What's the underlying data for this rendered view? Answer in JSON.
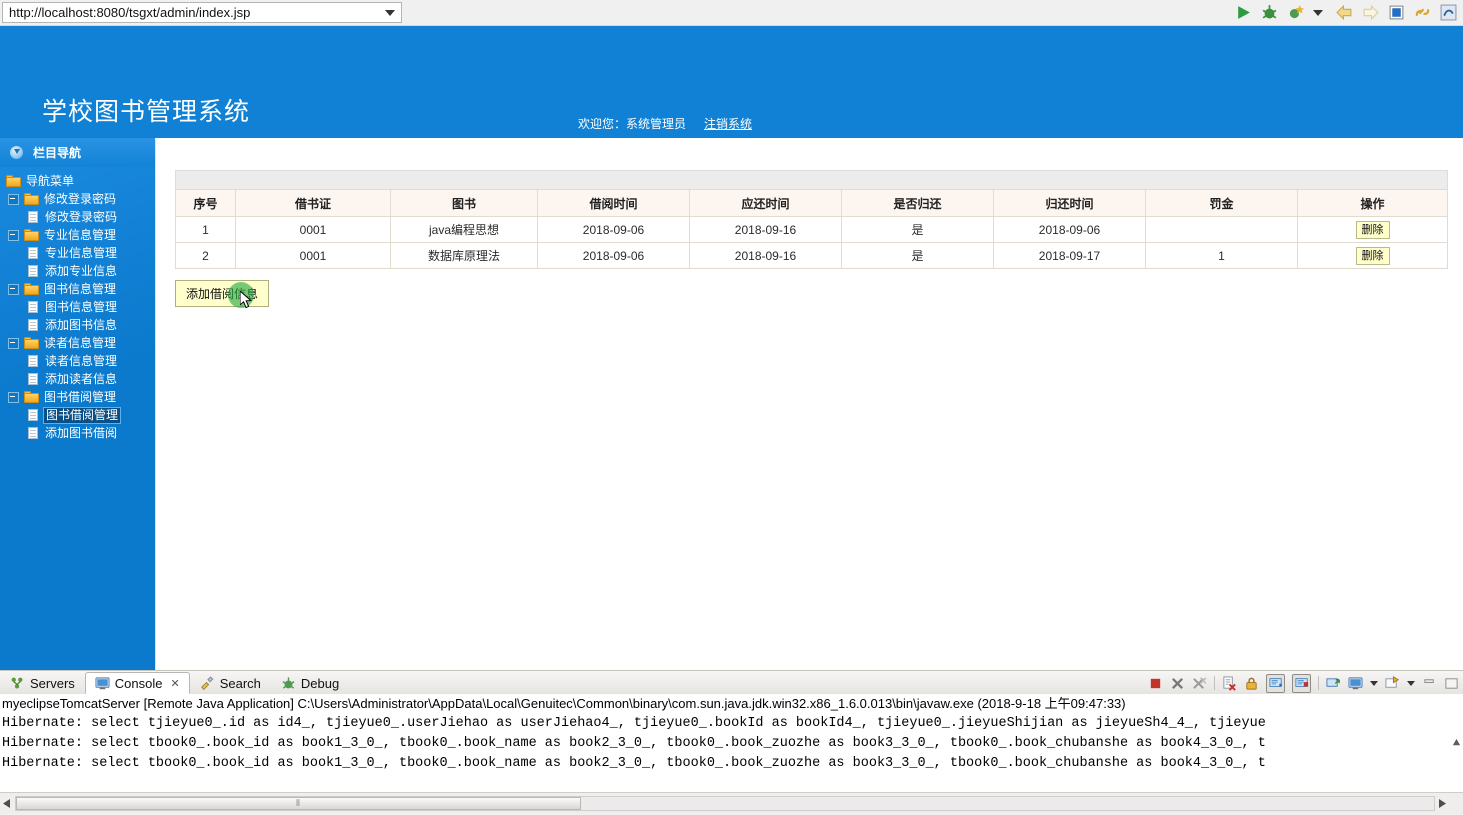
{
  "browser": {
    "url": "http://localhost:8080/tsgxt/admin/index.jsp",
    "dropdown_icon": "chevron-down-icon",
    "toolbar_icons": [
      "run-icon",
      "debug-icon",
      "external-tools-icon",
      "toolbar-dropdown-icon",
      "back-icon",
      "forward-icon",
      "stop-icon",
      "link-icon",
      "open-external-browser-icon"
    ]
  },
  "app": {
    "title": "学校图书管理系统",
    "welcome": "欢迎您：系统管理员",
    "logout": "注销系统",
    "brand_color": "#1081d4"
  },
  "sidebar": {
    "header": "栏目导航",
    "root": "导航菜单",
    "groups": [
      {
        "label": "修改登录密码",
        "items": [
          "修改登录密码"
        ]
      },
      {
        "label": "专业信息管理",
        "items": [
          "专业信息管理",
          "添加专业信息"
        ]
      },
      {
        "label": "图书信息管理",
        "items": [
          "图书信息管理",
          "添加图书信息"
        ]
      },
      {
        "label": "读者信息管理",
        "items": [
          "读者信息管理",
          "添加读者信息"
        ]
      },
      {
        "label": "图书借阅管理",
        "items": [
          "图书借阅管理",
          "添加图书借阅"
        ]
      }
    ],
    "selected_item": "图书借阅管理"
  },
  "table": {
    "headers": [
      "序号",
      "借书证",
      "图书",
      "借阅时间",
      "应还时间",
      "是否归还",
      "归还时间",
      "罚金",
      "操作"
    ],
    "rows": [
      {
        "no": "1",
        "card": "0001",
        "book": "java编程思想",
        "borrow_date": "2018-09-06",
        "due_date": "2018-09-16",
        "returned": "是",
        "return_date": "2018-09-06",
        "fine": "",
        "action": "删除"
      },
      {
        "no": "2",
        "card": "0001",
        "book": "数据库原理法",
        "borrow_date": "2018-09-06",
        "due_date": "2018-09-16",
        "returned": "是",
        "return_date": "2018-09-17",
        "fine": "1",
        "action": "删除"
      }
    ]
  },
  "actions": {
    "add_button": "添加借阅信息"
  },
  "console": {
    "tabs": [
      {
        "label": "Servers",
        "icon": "servers-icon",
        "active": false,
        "closable": false
      },
      {
        "label": "Console",
        "icon": "console-icon",
        "active": true,
        "closable": true,
        "close_glyph": "✕"
      },
      {
        "label": "Search",
        "icon": "search-icon",
        "active": false,
        "closable": false
      },
      {
        "label": "Debug",
        "icon": "debug-icon",
        "active": false,
        "closable": false
      }
    ],
    "toolbar_icons": [
      "terminate-icon",
      "remove-launch-icon",
      "remove-all-launches-icon",
      "clear-console-icon",
      "lock-scroll-icon",
      "scroll-lock-icon",
      "show-console-when-output-icon",
      "pin-console-icon",
      "display-selected-console-icon",
      "display-selected-console-dropdown-icon",
      "open-console-icon",
      "open-console-dropdown-icon",
      "minimize-icon",
      "maximize-icon"
    ],
    "lines": [
      "myeclipseTomcatServer [Remote Java Application] C:\\Users\\Administrator\\AppData\\Local\\Genuitec\\Common\\binary\\com.sun.java.jdk.win32.x86_1.6.0.013\\bin\\javaw.exe (2018-9-18 上午09:47:33)",
      "Hibernate: select tjieyue0_.id as id4_, tjieyue0_.userJiehao as userJiehao4_, tjieyue0_.bookId as bookId4_, tjieyue0_.jieyueShijian as jieyueSh4_4_, tjieyue",
      "Hibernate: select tbook0_.book_id as book1_3_0_, tbook0_.book_name as book2_3_0_, tbook0_.book_zuozhe as book3_3_0_, tbook0_.book_chubanshe as book4_3_0_, t",
      "Hibernate: select tbook0_.book_id as book1_3_0_, tbook0_.book_name as book2_3_0_, tbook0_.book_zuozhe as book3_3_0_, tbook0_.book_chubanshe as book4_3_0_, t"
    ],
    "hscroll_grip": "⦀"
  }
}
